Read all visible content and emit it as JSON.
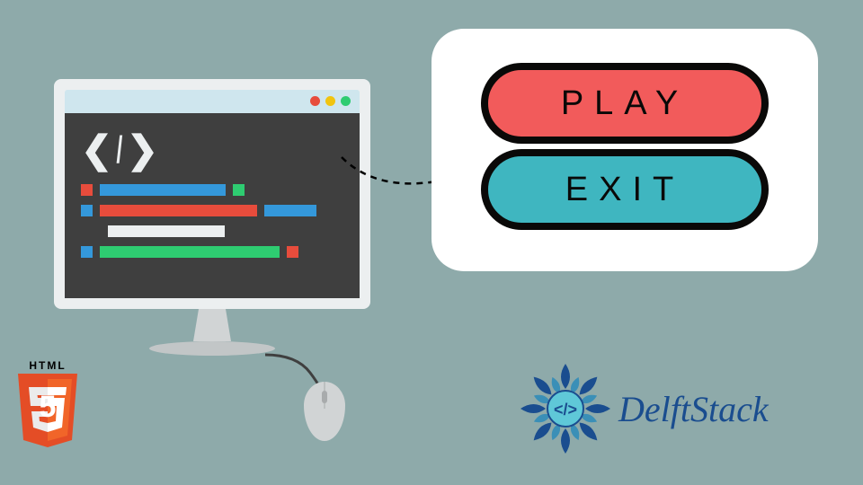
{
  "buttons": {
    "play": "PLAY",
    "exit": "EXIT"
  },
  "html5": {
    "label": "HTML",
    "number": "5"
  },
  "brand": {
    "name": "DelftStack"
  },
  "colors": {
    "background": "#8eaaaa",
    "playButton": "#f25b5b",
    "exitButton": "#3fb6c0",
    "html5Orange": "#e44d26",
    "html5Red": "#f16529",
    "brandBlue": "#1a4d8f"
  }
}
